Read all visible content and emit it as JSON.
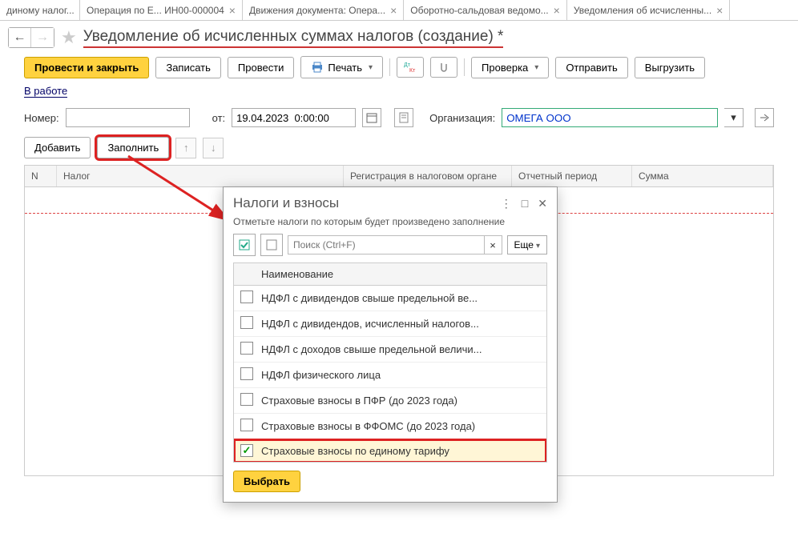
{
  "tabs": [
    {
      "label": "диному налог..."
    },
    {
      "label": "Операция по Е...  ИН00-000004"
    },
    {
      "label": "Движения документа: Опера..."
    },
    {
      "label": "Оборотно-сальдовая ведомо..."
    },
    {
      "label": "Уведомления об исчисленны..."
    }
  ],
  "header": {
    "title": "Уведомление об исчисленных суммах налогов (создание) *"
  },
  "toolbar": {
    "post_close": "Провести и закрыть",
    "write": "Записать",
    "post": "Провести",
    "print": "Печать",
    "check": "Проверка",
    "send": "Отправить",
    "export": "Выгрузить"
  },
  "status": {
    "label": "В работе"
  },
  "form": {
    "number_label": "Номер:",
    "number_value": "",
    "date_label": "от:",
    "date_value": "19.04.2023  0:00:00",
    "org_label": "Организация:",
    "org_value": "ОМЕГА ООО"
  },
  "subtoolbar": {
    "add": "Добавить",
    "fill": "Заполнить"
  },
  "grid": {
    "cols": [
      "N",
      "Налог",
      "Регистрация в налоговом органе",
      "Отчетный период",
      "Сумма"
    ]
  },
  "popup": {
    "title": "Налоги и взносы",
    "subtitle": "Отметьте налоги по которым будет произведено заполнение",
    "search_placeholder": "Поиск (Ctrl+F)",
    "more": "Еще",
    "col_name": "Наименование",
    "rows": [
      {
        "checked": false,
        "label": "НДФЛ с дивидендов свыше предельной ве..."
      },
      {
        "checked": false,
        "label": "НДФЛ с дивидендов, исчисленный налогов..."
      },
      {
        "checked": false,
        "label": "НДФЛ с доходов свыше предельной величи..."
      },
      {
        "checked": false,
        "label": "НДФЛ физического лица"
      },
      {
        "checked": false,
        "label": "Страховые взносы в ПФР (до 2023 года)"
      },
      {
        "checked": false,
        "label": "Страховые взносы в ФФОМС (до 2023 года)"
      },
      {
        "checked": true,
        "label": "Страховые взносы по единому тарифу"
      }
    ],
    "select_btn": "Выбрать"
  }
}
